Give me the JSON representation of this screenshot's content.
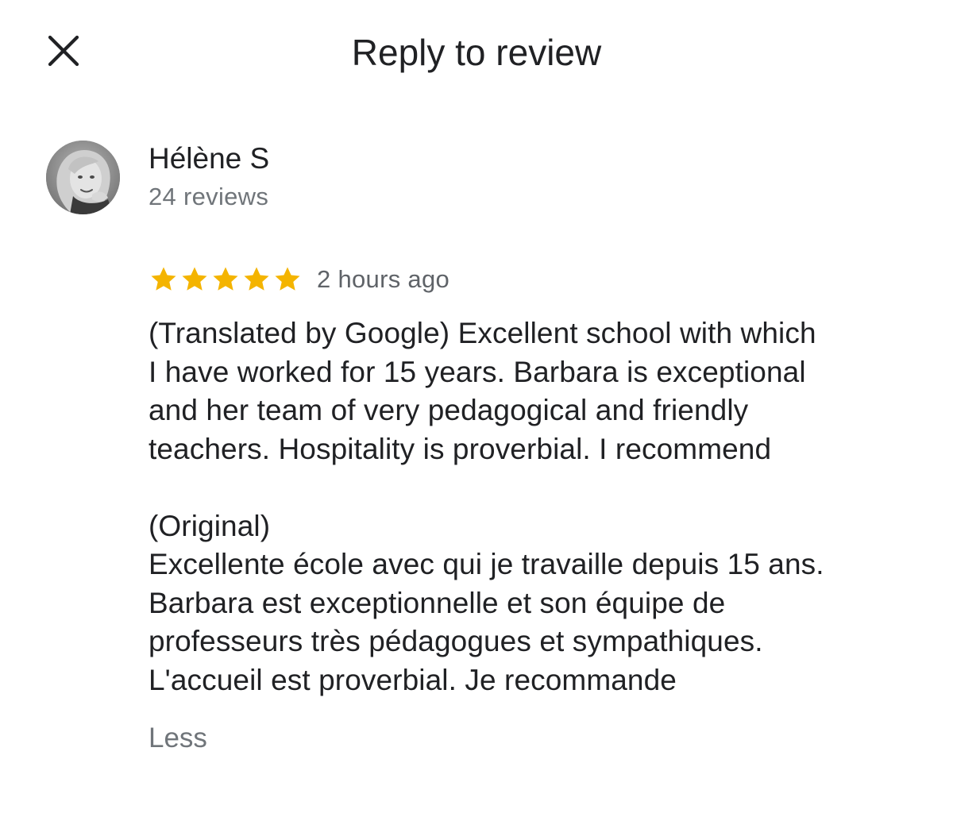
{
  "header": {
    "close_icon": "close-icon",
    "title": "Reply to review"
  },
  "reviewer": {
    "name": "Hélène S",
    "review_count": "24 reviews",
    "avatar": "reviewer-avatar-photo"
  },
  "review": {
    "rating": 5,
    "rating_max": 5,
    "star_color": "#f4b400",
    "time": "2 hours ago",
    "translated_text": "(Translated by Google) Excellent school with which\nI have worked for 15 years. Barbara is exceptional\nand her team of very pedagogical and friendly\nteachers. Hospitality is proverbial. I recommend",
    "original_label": "(Original)",
    "original_text": "Excellente école avec qui je travaille depuis 15 ans.\nBarbara est exceptionnelle et son équipe de\nprofesseurs très pédagogues et sympathiques.\nL'accueil est proverbial. Je recommande",
    "less_label": "Less"
  }
}
